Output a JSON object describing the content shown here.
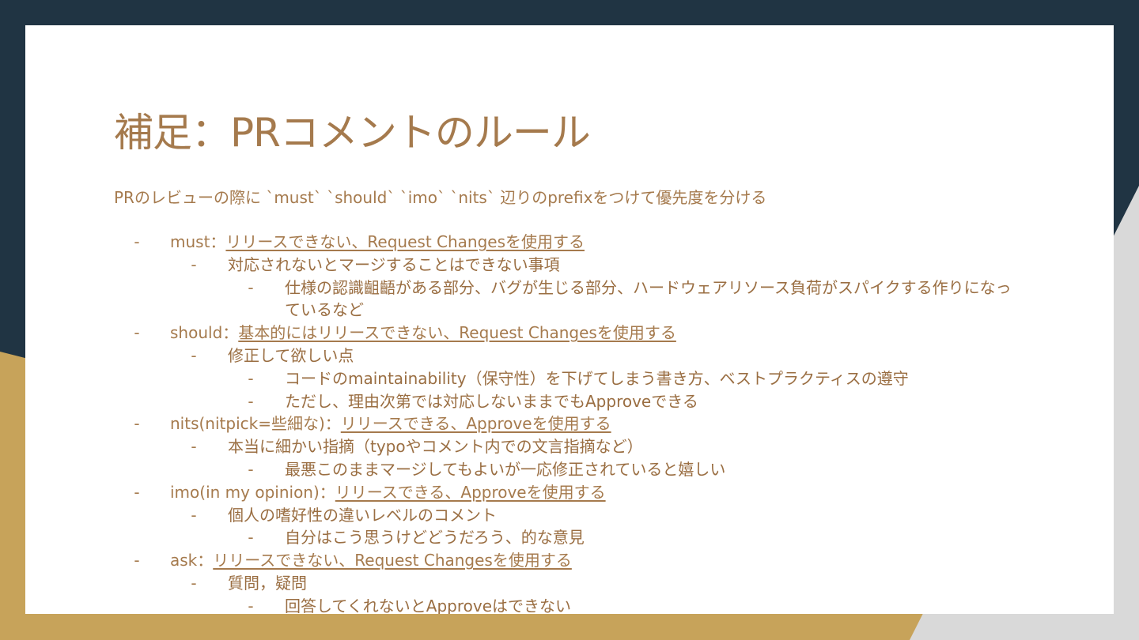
{
  "colors": {
    "background_dark": "#203443",
    "background_gold": "#c7a35a",
    "slide": "#ffffff",
    "text": "#a57a4d"
  },
  "slide": {
    "title": "補足：PRコメントのルール",
    "intro": "PRのレビューの際に `must` `should` `imo` `nits` 辺りのprefixをつけて優先度を分ける",
    "items": [
      {
        "dash": "-",
        "label": "must：",
        "link": "リリースできない、Request Changesを使用する",
        "children": [
          {
            "dash": "-",
            "text": "対応されないとマージすることはできない事項",
            "children": [
              {
                "dash": "-",
                "text": "仕様の認識齟齬がある部分、バグが生じる部分、ハードウェアリソース負荷がスパイクする作りになっているなど"
              }
            ]
          }
        ]
      },
      {
        "dash": "-",
        "label": "should：",
        "link": "基本的にはリリースできない、Request Changesを使用する",
        "children": [
          {
            "dash": "-",
            "text": "修正して欲しい点",
            "children": [
              {
                "dash": "-",
                "text": "コードのmaintainability（保守性）を下げてしまう書き方、ベストプラクティスの遵守"
              },
              {
                "dash": "-",
                "text": "ただし、理由次第では対応しないままでもApproveできる"
              }
            ]
          }
        ]
      },
      {
        "dash": "-",
        "label": "nits(nitpick=些細な)：",
        "link": "リリースできる、Approveを使用する",
        "children": [
          {
            "dash": "-",
            "text": "本当に細かい指摘（typoやコメント内での文言指摘など）",
            "children": [
              {
                "dash": "-",
                "text": "最悪このままマージしてもよいが一応修正されていると嬉しい"
              }
            ]
          }
        ]
      },
      {
        "dash": "-",
        "label": "imo(in my opinion)：",
        "link": "リリースできる、Approveを使用する",
        "children": [
          {
            "dash": "-",
            "text": "個人の嗜好性の違いレベルのコメント",
            "children": [
              {
                "dash": "-",
                "text": "自分はこう思うけどどうだろう、的な意見"
              }
            ]
          }
        ]
      },
      {
        "dash": "-",
        "label": "ask：",
        "link": "リリースできない、Request Changesを使用する",
        "children": [
          {
            "dash": "-",
            "text": "質問，疑問",
            "children": [
              {
                "dash": "-",
                "text": "回答してくれないとApproveはできない"
              }
            ]
          }
        ]
      }
    ]
  }
}
